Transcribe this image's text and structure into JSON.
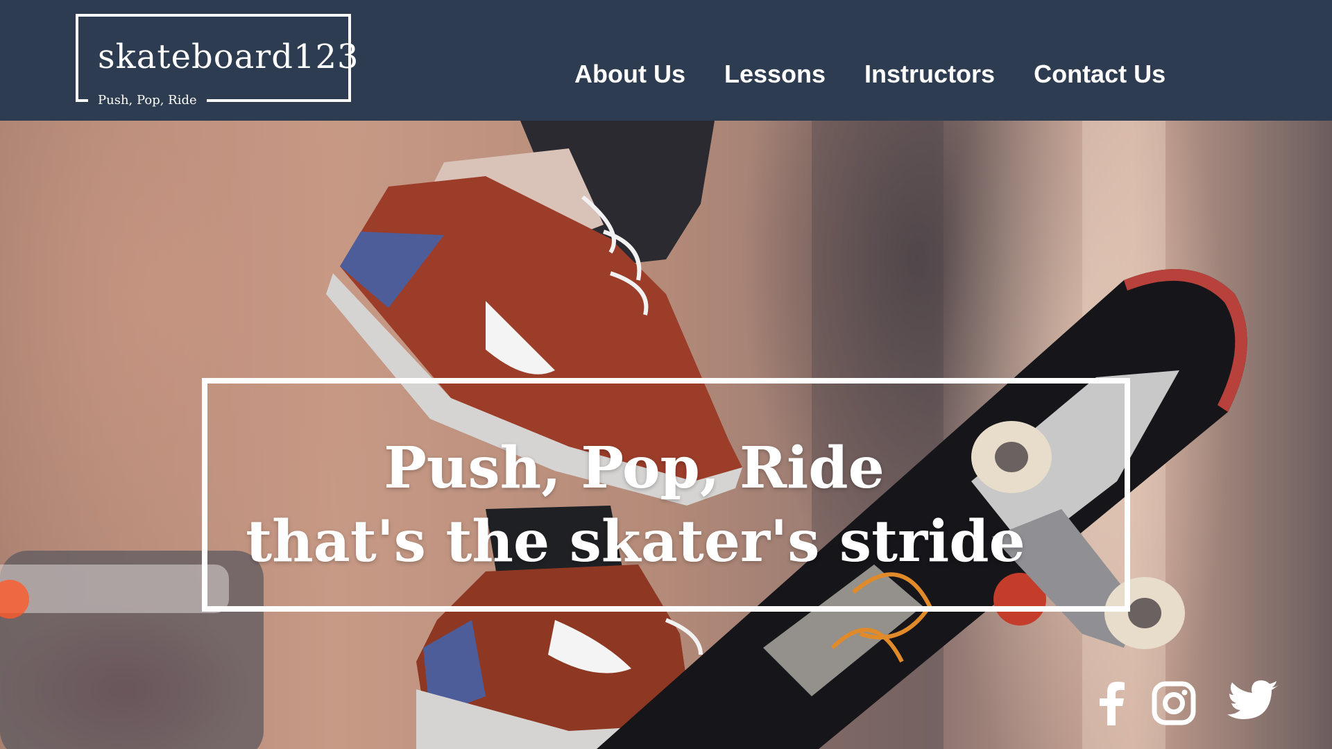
{
  "logo": {
    "name": "skateboard123",
    "tagline": "Push, Pop, Ride"
  },
  "nav": {
    "items": [
      {
        "label": "About Us"
      },
      {
        "label": "Lessons"
      },
      {
        "label": "Instructors"
      },
      {
        "label": "Contact Us"
      }
    ]
  },
  "hero": {
    "headline_line1": "Push, Pop, Ride",
    "headline_line2": "that's the skater's stride"
  },
  "social": {
    "icons": [
      "facebook-icon",
      "instagram-icon",
      "twitter-icon"
    ]
  },
  "colors": {
    "header_bg": "#2d3c50",
    "text": "#ffffff"
  }
}
